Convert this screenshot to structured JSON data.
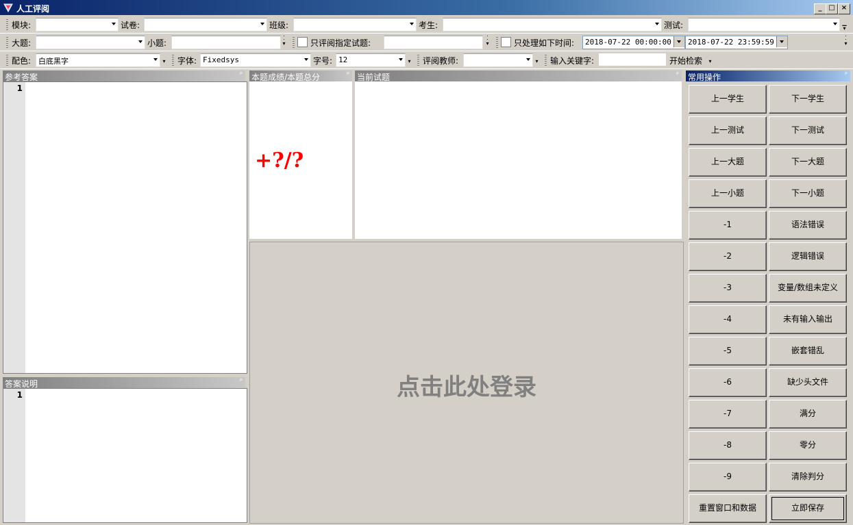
{
  "window": {
    "title": "人工评阅",
    "min_label": "_",
    "max_label": "□",
    "close_label": "×"
  },
  "toolbar1": {
    "module_label": "模块:",
    "paper_label": "试卷:",
    "class_label": "班级:",
    "student_label": "考生:",
    "test_label": "测试:"
  },
  "toolbar2": {
    "big_q_label": "大题:",
    "small_q_label": "小题:",
    "only_review_label": "只评阅指定试题:",
    "only_time_label": "只处理如下时间:",
    "time_start": "2018-07-22 00:00:00",
    "time_end": "2018-07-22 23:59:59"
  },
  "toolbar3": {
    "color_label": "配色:",
    "color_value": "白底黑字",
    "font_label": "字体:",
    "font_value": "Fixedsys",
    "size_label": "字号:",
    "size_value": "12",
    "teacher_label": "评阅教师:",
    "keyword_label": "输入关键字:",
    "search_label": "开始检索"
  },
  "panels": {
    "reference_answer": "参考答案",
    "answer_notes": "答案说明",
    "score_panel": "本题成绩/本题总分",
    "current_question": "当前试题",
    "common_ops": "常用操作",
    "line_number": "1",
    "score_text": "+?/?",
    "login_text": "点击此处登录"
  },
  "buttons": [
    [
      "上一学生",
      "下一学生"
    ],
    [
      "上一测试",
      "下一测试"
    ],
    [
      "上一大题",
      "下一大题"
    ],
    [
      "上一小题",
      "下一小题"
    ],
    [
      "-1",
      "语法错误"
    ],
    [
      "-2",
      "逻辑错误"
    ],
    [
      "-3",
      "变量/数组未定义"
    ],
    [
      "-4",
      "未有输入输出"
    ],
    [
      "-5",
      "嵌套错乱"
    ],
    [
      "-6",
      "缺少头文件"
    ],
    [
      "-7",
      "满分"
    ],
    [
      "-8",
      "零分"
    ],
    [
      "-9",
      "清除判分"
    ],
    [
      "重置窗口和数据",
      "立即保存"
    ]
  ]
}
